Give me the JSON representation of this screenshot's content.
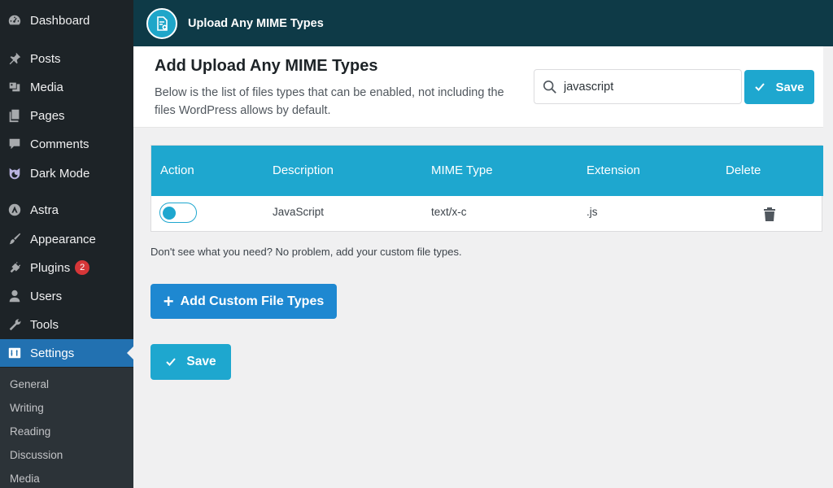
{
  "sidebar": {
    "items": [
      {
        "label": "Dashboard",
        "icon": "dashboard-icon"
      },
      {
        "label": "Posts",
        "icon": "pushpin-icon"
      },
      {
        "label": "Media",
        "icon": "media-icon"
      },
      {
        "label": "Pages",
        "icon": "pages-icon"
      },
      {
        "label": "Comments",
        "icon": "comment-icon"
      },
      {
        "label": "Dark Mode",
        "icon": "moon-icon"
      },
      {
        "label": "Astra",
        "icon": "astra-icon"
      },
      {
        "label": "Appearance",
        "icon": "brush-icon"
      },
      {
        "label": "Plugins",
        "icon": "plug-icon",
        "badge": "2"
      },
      {
        "label": "Users",
        "icon": "user-icon"
      },
      {
        "label": "Tools",
        "icon": "wrench-icon"
      },
      {
        "label": "Settings",
        "icon": "settings-icon",
        "active": true
      }
    ],
    "submenu": [
      "General",
      "Writing",
      "Reading",
      "Discussion",
      "Media"
    ]
  },
  "topbar": {
    "title": "Upload Any MIME Types"
  },
  "header": {
    "title": "Add Upload Any MIME Types",
    "description": "Below is the list of files types that can be enabled, not including the files WordPress allows by default.",
    "search_value": "javascript",
    "save_label": "Save"
  },
  "table": {
    "columns": [
      "Action",
      "Description",
      "MIME Type",
      "Extension",
      "Delete"
    ],
    "rows": [
      {
        "enabled": true,
        "description": "JavaScript",
        "mime": "text/x-c",
        "extension": ".js"
      }
    ]
  },
  "hint": "Don't see what you need? No problem, add your custom file types.",
  "add_button_label": "Add Custom File Types",
  "bottom_save_label": "Save",
  "colors": {
    "sidebar_bg": "#1d2327",
    "active_menu": "#2271b1",
    "topbar_bg": "#0e3a47",
    "accent": "#1ea7cf",
    "add_button": "#1e88d1",
    "badge": "#d63638"
  }
}
